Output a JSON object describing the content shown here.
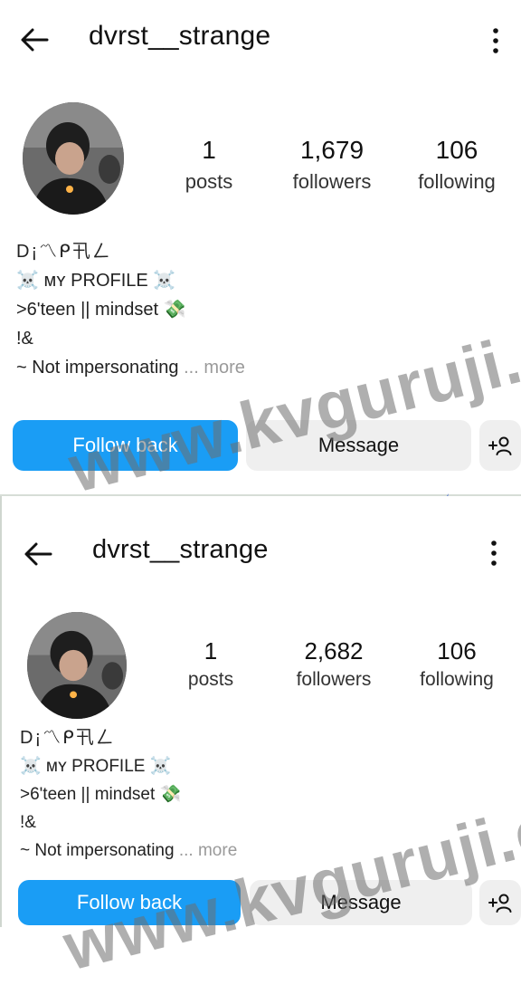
{
  "panels": [
    {
      "header": {
        "username": "dvrst__strange"
      },
      "stats": {
        "posts": {
          "value": "1",
          "label": "posts"
        },
        "followers": {
          "value": "1,679",
          "label": "followers"
        },
        "following": {
          "value": "106",
          "label": "following"
        }
      },
      "bio": {
        "name": "D¡〽ᑭ卂ㄥ",
        "lines": [
          "☠️ ᴍʏ PROFILE ☠️",
          ">6'teen || mindset 💸",
          "!&"
        ],
        "truncated": "~ Not impersonating",
        "more": "... more"
      },
      "buttons": {
        "follow_back": "Follow back",
        "message": "Message"
      }
    },
    {
      "header": {
        "username": "dvrst__strange"
      },
      "stats": {
        "posts": {
          "value": "1",
          "label": "posts"
        },
        "followers": {
          "value": "2,682",
          "label": "followers"
        },
        "following": {
          "value": "106",
          "label": "following"
        }
      },
      "bio": {
        "name": "D¡〽ᑭ卂ㄥ",
        "lines": [
          "☠️ ᴍʏ PROFILE ☠️",
          ">6'teen || mindset 💸",
          "!&"
        ],
        "truncated": "~ Not impersonating",
        "more": "... more"
      },
      "buttons": {
        "follow_back": "Follow back",
        "message": "Message"
      }
    }
  ],
  "watermark": "www.kvguruji.com",
  "icons": [
    "back-arrow-icon",
    "more-options-icon",
    "add-person-icon",
    "lightning-icon"
  ],
  "colors": {
    "follow_button": "#1a9df5",
    "message_button": "#efefef",
    "watermark": "#6e6e6e"
  }
}
